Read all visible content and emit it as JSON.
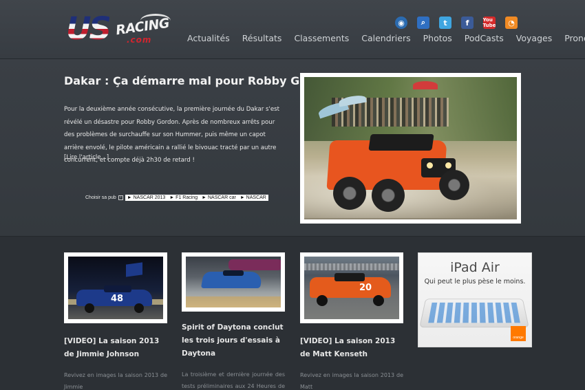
{
  "site": {
    "logo_main": "US",
    "logo_racing": "RACING",
    "logo_com": ".com"
  },
  "social": [
    {
      "icon": "site-rss-icon",
      "glyph": "◉"
    },
    {
      "icon": "search-icon",
      "glyph": "⌕"
    },
    {
      "icon": "twitter-icon",
      "glyph": "t"
    },
    {
      "icon": "facebook-icon",
      "glyph": "f"
    },
    {
      "icon": "youtube-icon",
      "glyph": "You\nTube"
    },
    {
      "icon": "rss-icon",
      "glyph": "◔"
    }
  ],
  "nav": [
    "Actualités",
    "Résultats",
    "Classements",
    "Calendriers",
    "Photos",
    "PodCasts",
    "Voyages",
    "Pronostics"
  ],
  "feature": {
    "title": "Dakar : Ça démarre mal pour Robby Gordon",
    "text": "Pour la deuxième année consécutive, la première journée du Dakar s'est révélé un désastre pour Robby Gordon. Après de nombreux arrêts pour des problèmes de surchauffe sur son Hummer, puis même un capot arrière envolé, le pilote américain a rallié le bivouac tracté par un autre concurrent, et compte déjà 2h30 de retard !",
    "read_more": "[Lire l'article...]"
  },
  "pub": {
    "label": "Choisir sa pub",
    "info": "i",
    "links": [
      "► NASCAR 2013",
      "► F1 Racing",
      "► NASCAR car",
      "► NASCAR"
    ]
  },
  "cards": [
    {
      "title": "[VIDEO] La saison 2013 de Jimmie Johnson",
      "excerpt": "Revivez en images la saison 2013 de Jimmie"
    },
    {
      "title": "Spirit of Daytona conclut les trois jours d'essais à Daytona",
      "excerpt": "La troisième et dernière journée des tests préliminaires aux 24 Heures de Daytona a été"
    },
    {
      "title": "[VIDEO] La saison 2013 de Matt Kenseth",
      "excerpt": "Revivez en images la saison 2013 de Matt"
    }
  ],
  "ad": {
    "title": "iPad Air",
    "subtitle": "Qui peut le plus pèse le moins.",
    "brand": "orange"
  }
}
